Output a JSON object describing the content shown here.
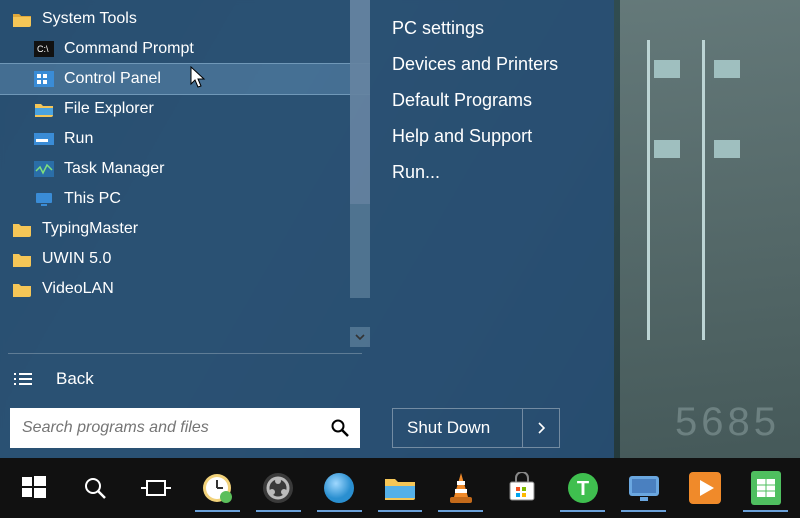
{
  "start_menu": {
    "programs": {
      "group": "System Tools",
      "items": [
        {
          "label": "Command Prompt",
          "icon": "cmd-icon"
        },
        {
          "label": "Control Panel",
          "icon": "control-panel-icon",
          "highlighted": true
        },
        {
          "label": "File Explorer",
          "icon": "file-explorer-icon"
        },
        {
          "label": "Run",
          "icon": "run-icon"
        },
        {
          "label": "Task Manager",
          "icon": "task-manager-icon"
        },
        {
          "label": "This PC",
          "icon": "this-pc-icon"
        }
      ],
      "folders": [
        {
          "label": "TypingMaster"
        },
        {
          "label": "UWIN 5.0"
        },
        {
          "label": "VideoLAN"
        }
      ]
    },
    "back_label": "Back",
    "search_placeholder": "Search programs and files",
    "quick_links": [
      "PC settings",
      "Devices and Printers",
      "Default Programs",
      "Help and Support",
      "Run..."
    ],
    "shutdown_label": "Shut Down"
  },
  "wallpaper_watermark": "5685",
  "taskbar": {
    "buttons": [
      {
        "name": "start-button",
        "icon": "windows-logo-icon"
      },
      {
        "name": "search-button",
        "icon": "magnifier-icon"
      },
      {
        "name": "task-view-button",
        "icon": "task-view-icon"
      },
      {
        "name": "taskbar-app-clock",
        "icon": "clock-app-icon",
        "running": true
      },
      {
        "name": "taskbar-app-obs",
        "icon": "obs-icon",
        "running": true
      },
      {
        "name": "taskbar-app-blueorb",
        "icon": "blue-circle-icon",
        "running": true
      },
      {
        "name": "taskbar-file-explorer",
        "icon": "file-explorer-icon",
        "running": true
      },
      {
        "name": "taskbar-app-vlc",
        "icon": "vlc-icon",
        "running": true
      },
      {
        "name": "taskbar-app-store",
        "icon": "store-icon",
        "running": false
      },
      {
        "name": "taskbar-app-green-t",
        "icon": "green-t-icon",
        "running": true
      },
      {
        "name": "taskbar-app-remote",
        "icon": "remote-desktop-icon",
        "running": true
      },
      {
        "name": "taskbar-app-media",
        "icon": "media-player-icon",
        "running": false
      },
      {
        "name": "taskbar-app-sheets",
        "icon": "spreadsheet-icon",
        "running": true
      }
    ]
  }
}
